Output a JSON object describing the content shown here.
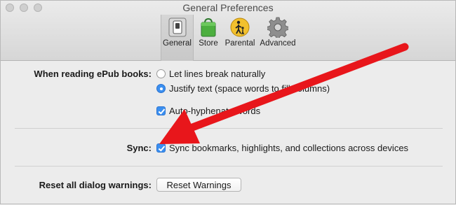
{
  "window": {
    "title": "General Preferences"
  },
  "toolbar": {
    "tabs": [
      {
        "label": "General",
        "icon": "switch-icon"
      },
      {
        "label": "Store",
        "icon": "shopping-bag-icon"
      },
      {
        "label": "Parental",
        "icon": "parental-controls-icon"
      },
      {
        "label": "Advanced",
        "icon": "gear-icon"
      }
    ]
  },
  "epub": {
    "label": "When reading ePub books:",
    "option_natural": "Let lines break naturally",
    "option_justify": "Justify text (space words to fill columns)",
    "selected": "justify",
    "hyphenate_label": "Auto-hyphenate words",
    "hyphenate_checked": true
  },
  "sync": {
    "label": "Sync:",
    "option": "Sync bookmarks, highlights, and collections across devices",
    "checked": true
  },
  "reset": {
    "label": "Reset all dialog warnings:",
    "button": "Reset Warnings"
  },
  "colors": {
    "accent": "#3b8ff0",
    "arrow": "#e8161b"
  }
}
